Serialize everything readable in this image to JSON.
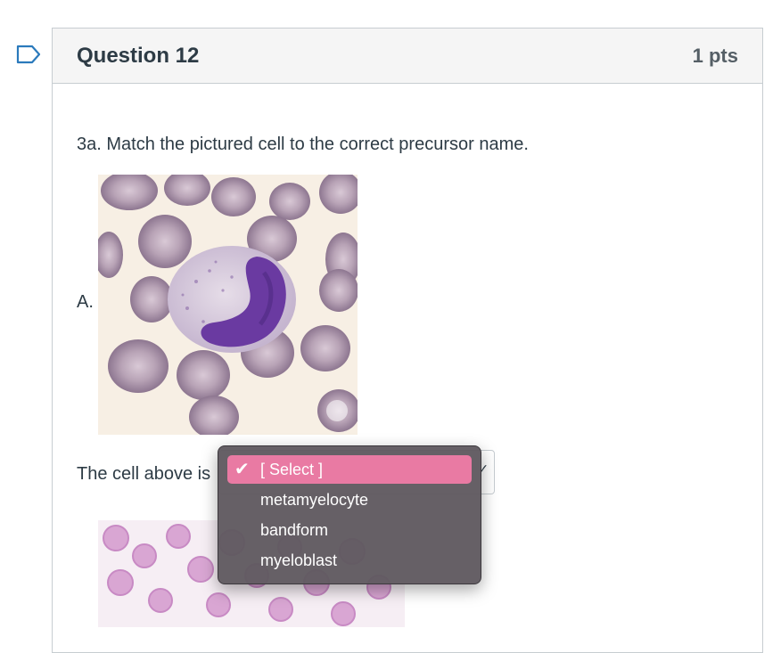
{
  "question": {
    "title": "Question 12",
    "points": "1 pts",
    "prompt": "3a. Match the pictured cell to the correct precursor name.",
    "item_label": "A.",
    "sentence": "The cell above is"
  },
  "dropdown": {
    "options": [
      {
        "label": "[ Select ]",
        "selected": true
      },
      {
        "label": "metamyelocyte",
        "selected": false
      },
      {
        "label": "bandform",
        "selected": false
      },
      {
        "label": "myeloblast",
        "selected": false
      }
    ],
    "highlight_color": "#e97aa3",
    "menu_bg": "#5f5a60"
  },
  "icons": {
    "flag": "bookmark-flag-icon",
    "check": "checkmark-icon",
    "chevron": "chevron-down-icon"
  },
  "colors": {
    "flag_blue": "#2b7abc",
    "text": "#2d3b45",
    "header_bg": "#f5f5f5"
  }
}
